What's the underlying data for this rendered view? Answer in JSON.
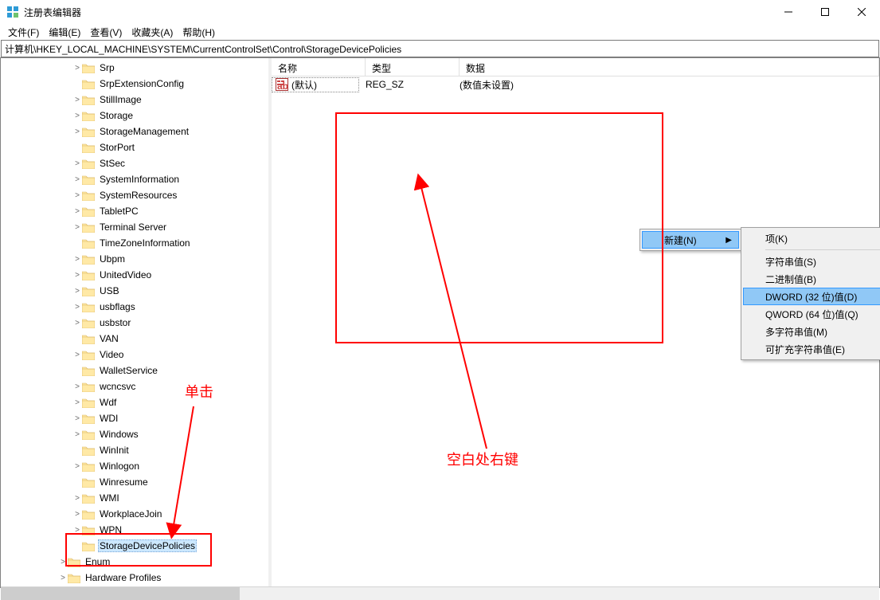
{
  "title": "注册表编辑器",
  "menus": {
    "file": "文件(F)",
    "edit": "编辑(E)",
    "view": "查看(V)",
    "favorites": "收藏夹(A)",
    "help": "帮助(H)"
  },
  "address": "计算机\\HKEY_LOCAL_MACHINE\\SYSTEM\\CurrentControlSet\\Control\\StorageDevicePolicies",
  "columns": {
    "name": "名称",
    "type": "类型",
    "data": "数据"
  },
  "list_row": {
    "name": "(默认)",
    "type": "REG_SZ",
    "data": "(数值未设置)"
  },
  "tree_items": [
    {
      "indent": 5,
      "twisty": ">",
      "label": "Srp"
    },
    {
      "indent": 5,
      "twisty": "",
      "label": "SrpExtensionConfig"
    },
    {
      "indent": 5,
      "twisty": ">",
      "label": "StillImage"
    },
    {
      "indent": 5,
      "twisty": ">",
      "label": "Storage"
    },
    {
      "indent": 5,
      "twisty": ">",
      "label": "StorageManagement"
    },
    {
      "indent": 5,
      "twisty": "",
      "label": "StorPort"
    },
    {
      "indent": 5,
      "twisty": ">",
      "label": "StSec"
    },
    {
      "indent": 5,
      "twisty": ">",
      "label": "SystemInformation"
    },
    {
      "indent": 5,
      "twisty": ">",
      "label": "SystemResources"
    },
    {
      "indent": 5,
      "twisty": ">",
      "label": "TabletPC"
    },
    {
      "indent": 5,
      "twisty": ">",
      "label": "Terminal Server"
    },
    {
      "indent": 5,
      "twisty": "",
      "label": "TimeZoneInformation"
    },
    {
      "indent": 5,
      "twisty": ">",
      "label": "Ubpm"
    },
    {
      "indent": 5,
      "twisty": ">",
      "label": "UnitedVideo"
    },
    {
      "indent": 5,
      "twisty": ">",
      "label": "USB"
    },
    {
      "indent": 5,
      "twisty": ">",
      "label": "usbflags"
    },
    {
      "indent": 5,
      "twisty": ">",
      "label": "usbstor"
    },
    {
      "indent": 5,
      "twisty": "",
      "label": "VAN"
    },
    {
      "indent": 5,
      "twisty": ">",
      "label": "Video"
    },
    {
      "indent": 5,
      "twisty": "",
      "label": "WalletService"
    },
    {
      "indent": 5,
      "twisty": ">",
      "label": "wcncsvc"
    },
    {
      "indent": 5,
      "twisty": ">",
      "label": "Wdf"
    },
    {
      "indent": 5,
      "twisty": ">",
      "label": "WDI"
    },
    {
      "indent": 5,
      "twisty": ">",
      "label": "Windows"
    },
    {
      "indent": 5,
      "twisty": "",
      "label": "WinInit"
    },
    {
      "indent": 5,
      "twisty": ">",
      "label": "Winlogon"
    },
    {
      "indent": 5,
      "twisty": "",
      "label": "Winresume"
    },
    {
      "indent": 5,
      "twisty": ">",
      "label": "WMI"
    },
    {
      "indent": 5,
      "twisty": ">",
      "label": "WorkplaceJoin"
    },
    {
      "indent": 5,
      "twisty": ">",
      "label": "WPN"
    },
    {
      "indent": 5,
      "twisty": "",
      "label": "StorageDevicePolicies",
      "selected": true
    },
    {
      "indent": 4,
      "twisty": ">",
      "label": "Enum"
    },
    {
      "indent": 4,
      "twisty": ">",
      "label": "Hardware Profiles"
    }
  ],
  "context_menu": {
    "new_label": "新建(N)",
    "sub": [
      {
        "label": "项(K)"
      },
      {
        "sep": true
      },
      {
        "label": "字符串值(S)"
      },
      {
        "label": "二进制值(B)"
      },
      {
        "label": "DWORD (32 位)值(D)",
        "hover": true
      },
      {
        "label": "QWORD (64 位)值(Q)"
      },
      {
        "label": "多字符串值(M)"
      },
      {
        "label": "可扩充字符串值(E)"
      }
    ]
  },
  "annotations": {
    "click_label": "单击",
    "rightclick_label": "空白处右键"
  }
}
